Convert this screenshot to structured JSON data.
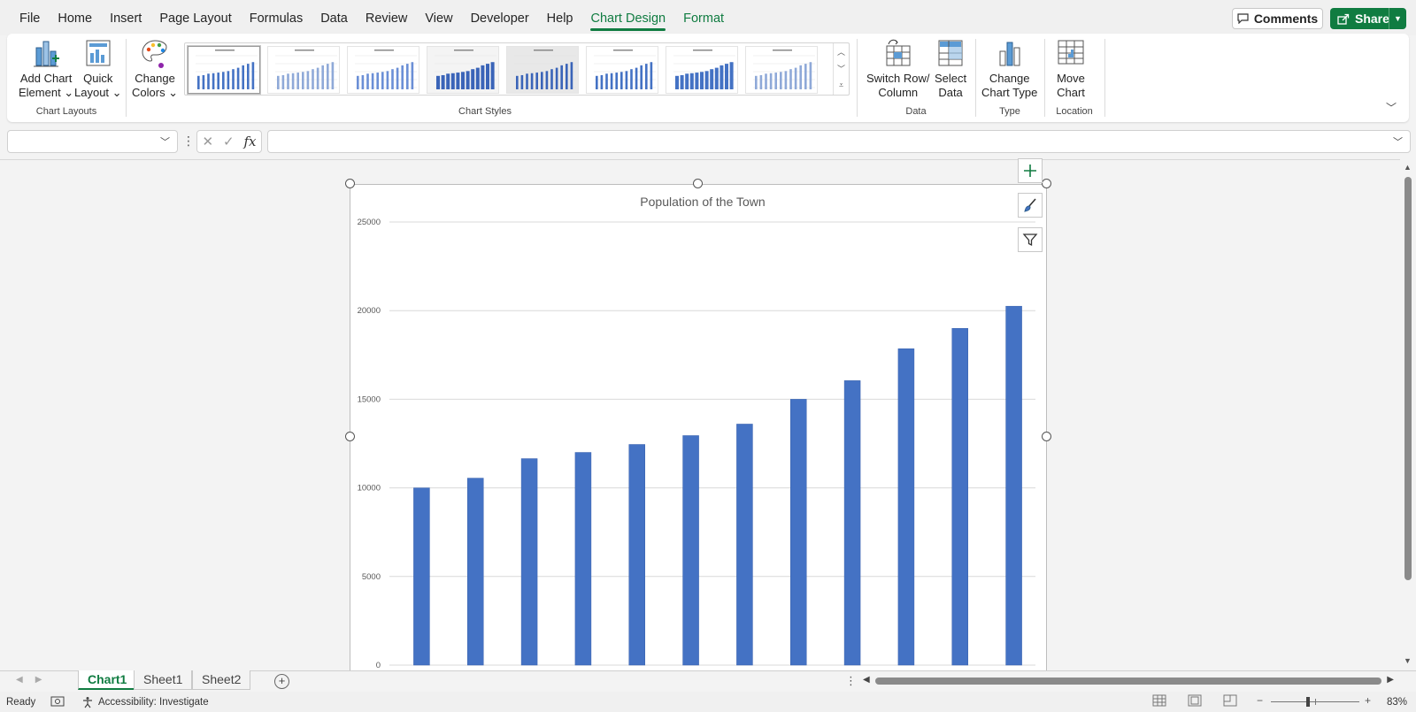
{
  "menu": {
    "tabs": [
      "File",
      "Home",
      "Insert",
      "Page Layout",
      "Formulas",
      "Data",
      "Review",
      "View",
      "Developer",
      "Help",
      "Chart Design",
      "Format"
    ],
    "active_tab": "Chart Design",
    "comments_label": "Comments",
    "share_label": "Share"
  },
  "ribbon": {
    "chart_layouts": {
      "label": "Chart Layouts",
      "add_chart_element": [
        "Add Chart",
        "Element ⌄"
      ],
      "quick_layout": [
        "Quick",
        "Layout ⌄"
      ]
    },
    "chart_styles": {
      "label": "Chart Styles",
      "change_colors": [
        "Change",
        "Colors ⌄"
      ],
      "style_count": 8,
      "selected_style": 1
    },
    "data": {
      "label": "Data",
      "switch_row_column": [
        "Switch Row/",
        "Column"
      ],
      "select_data": [
        "Select",
        "Data"
      ]
    },
    "type": {
      "label": "Type",
      "change_chart_type": [
        "Change",
        "Chart Type"
      ]
    },
    "location": {
      "label": "Location",
      "move_chart": [
        "Move",
        "Chart"
      ]
    }
  },
  "formula_bar": {
    "name_box": "",
    "formula": "",
    "fx_label": "fx"
  },
  "chart_data": {
    "type": "bar",
    "title": "Population of the Town",
    "categories": [
      "",
      "",
      "",
      "",
      "",
      "",
      "",
      "",
      "",
      "",
      "",
      ""
    ],
    "values": [
      10000,
      10550,
      11650,
      12000,
      12450,
      12950,
      13600,
      15000,
      16050,
      17850,
      19000,
      20250
    ],
    "ylim": [
      0,
      25000
    ],
    "yticks": [
      0,
      5000,
      10000,
      15000,
      20000,
      25000
    ],
    "grid": true,
    "bar_color": "#4472c4",
    "legend": "none"
  },
  "sheets": {
    "tabs": [
      "Chart1",
      "Sheet1",
      "Sheet2"
    ],
    "active": "Chart1"
  },
  "status": {
    "ready": "Ready",
    "accessibility": "Accessibility: Investigate",
    "zoom": "83%"
  },
  "colors": {
    "accent": "#107c41",
    "bar": "#4472c4"
  }
}
